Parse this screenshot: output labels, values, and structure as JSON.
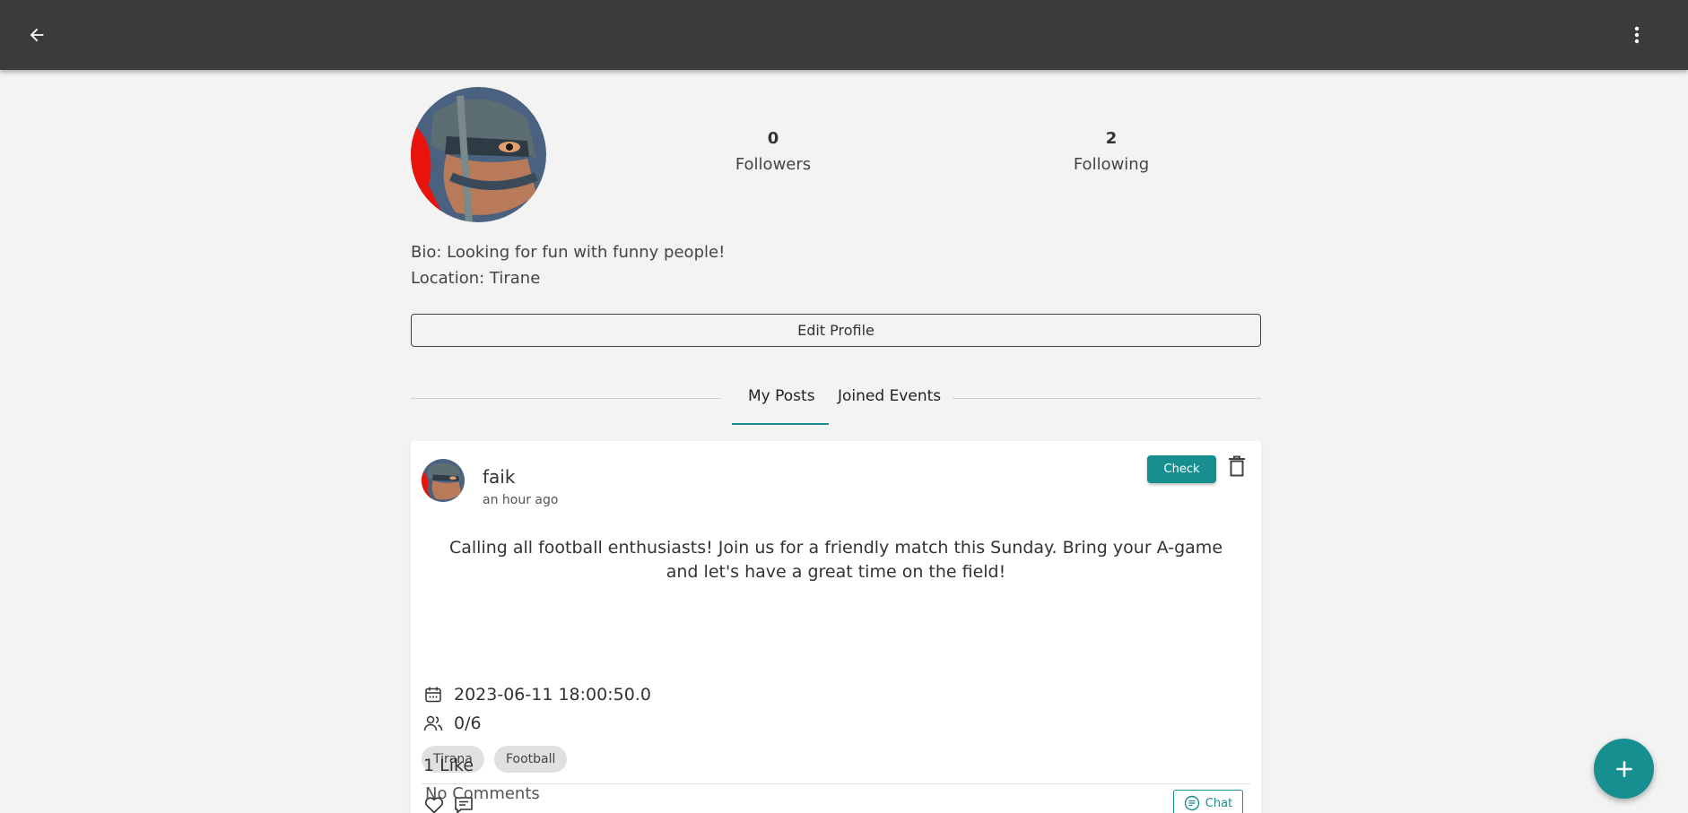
{
  "header": {
    "back_icon": "arrow-left-icon",
    "menu_icon": "more-vertical-icon"
  },
  "profile": {
    "followers_count": "0",
    "followers_label": "Followers",
    "following_count": "2",
    "following_label": "Following",
    "bio": "Bio: Looking for fun with funny people!",
    "location": "Location: Tirane",
    "edit_label": "Edit Profile"
  },
  "tabs": [
    {
      "label": "My Posts",
      "active": true
    },
    {
      "label": "Joined Events",
      "active": false
    }
  ],
  "post": {
    "author": "faik",
    "time": "an hour ago",
    "check_label": "Check",
    "text": "Calling all football enthusiasts! Join us for a friendly match this Sunday. Bring your A-game and let's have a great time on the field!",
    "date": "2023-06-11 18:00:50.0",
    "participants": "0/6",
    "tags": [
      "Tirana",
      "Football"
    ],
    "chat_label": "Chat",
    "likes": "1 Like",
    "comments": "No Comments"
  },
  "colors": {
    "accent": "#178f91",
    "header_bg": "#3c3b3c",
    "page_bg": "#f3f3f3"
  },
  "fab": {
    "icon": "plus-icon"
  }
}
